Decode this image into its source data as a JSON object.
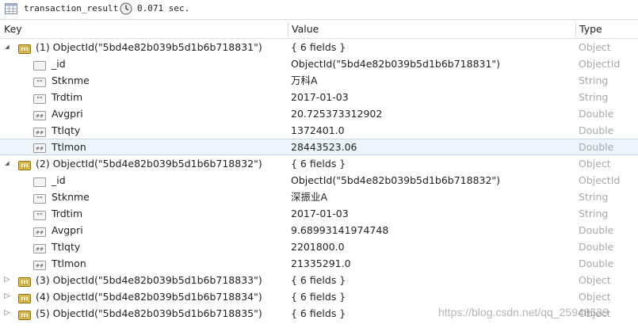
{
  "toolbar": {
    "collection": "transaction_result",
    "elapsed": "0.071 sec.",
    "table_icon": "table-icon",
    "clock_icon": "clock-icon"
  },
  "columns": {
    "key": "Key",
    "value": "Value",
    "type": "Type"
  },
  "documents": [
    {
      "key": "(1) ObjectId(\"5bd4e82b039b5d1b6b718831\")",
      "value": "{ 6 fields }",
      "type": "Object",
      "fields": [
        {
          "name": "_id",
          "value": "ObjectId(\"5bd4e82b039b5d1b6b718831\")",
          "type": "ObjectId",
          "icon": "objectid-icon"
        },
        {
          "name": "Stknme",
          "value": "万科A",
          "type": "String",
          "icon": "string-icon"
        },
        {
          "name": "Trdtim",
          "value": "2017-01-03",
          "type": "String",
          "icon": "string-icon"
        },
        {
          "name": "Avgpri",
          "value": "20.725373312902",
          "type": "Double",
          "icon": "number-icon"
        },
        {
          "name": "Ttlqty",
          "value": "1372401.0",
          "type": "Double",
          "icon": "number-icon"
        },
        {
          "name": "Ttlmon",
          "value": "28443523.06",
          "type": "Double",
          "icon": "number-icon"
        }
      ]
    },
    {
      "key": "(2) ObjectId(\"5bd4e82b039b5d1b6b718832\")",
      "value": "{ 6 fields }",
      "type": "Object",
      "fields": [
        {
          "name": "_id",
          "value": "ObjectId(\"5bd4e82b039b5d1b6b718832\")",
          "type": "ObjectId",
          "icon": "objectid-icon"
        },
        {
          "name": "Stknme",
          "value": "深振业A",
          "type": "String",
          "icon": "string-icon"
        },
        {
          "name": "Trdtim",
          "value": "2017-01-03",
          "type": "String",
          "icon": "string-icon"
        },
        {
          "name": "Avgpri",
          "value": "9.68993141974748",
          "type": "Double",
          "icon": "number-icon"
        },
        {
          "name": "Ttlqty",
          "value": "2201800.0",
          "type": "Double",
          "icon": "number-icon"
        },
        {
          "name": "Ttlmon",
          "value": "21335291.0",
          "type": "Double",
          "icon": "number-icon"
        }
      ]
    },
    {
      "key": "(3) ObjectId(\"5bd4e82b039b5d1b6b718833\")",
      "value": "{ 6 fields }",
      "type": "Object"
    },
    {
      "key": "(4) ObjectId(\"5bd4e82b039b5d1b6b718834\")",
      "value": "{ 6 fields }",
      "type": "Object"
    },
    {
      "key": "(5) ObjectId(\"5bd4e82b039b5d1b6b718835\")",
      "value": "{ 6 fields }",
      "type": "Object"
    }
  ],
  "watermark": "https://blog.csdn.net/qq_25948539"
}
